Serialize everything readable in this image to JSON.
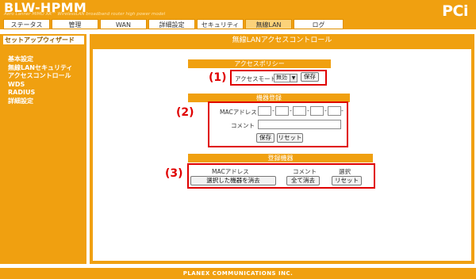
{
  "header": {
    "title": "BLW-HPMM",
    "subtitle": "Aero Lanner MIMO XR™ WirelessLAN broadband router high power model",
    "logo": "PCi"
  },
  "tabs": [
    "ステータス",
    "管理",
    "WAN",
    "詳細設定",
    "セキュリティ",
    "無線LAN",
    "ログ"
  ],
  "sidebar": {
    "heading": "セットアップウィザード",
    "items": [
      "基本設定",
      "無線LANセキュリティ",
      "アクセスコントロール",
      "WDS",
      "RADIUS",
      "詳細設定"
    ]
  },
  "main": {
    "title": "無線LANアクセスコントロール",
    "policy": {
      "title": "アクセスポリシー",
      "number": "(1)",
      "mode_label": "アクセスモード",
      "mode_value": "無効",
      "save": "保存"
    },
    "register": {
      "title": "機器登録",
      "number": "(2)",
      "mac_label": "MACアドレス",
      "comment_label": "コメント",
      "save": "保存",
      "reset": "リセット"
    },
    "registered": {
      "title": "登録機器",
      "number": "(3)",
      "col_mac": "MACアドレス",
      "col_comment": "コメント",
      "col_select": "選択",
      "delete_selected": "選択した機器を消去",
      "delete_all": "全て消去",
      "reset": "リセット"
    }
  },
  "footer": "PLANEX COMMUNICATIONS INC.",
  "colors": {
    "accent": "#f0a010",
    "highlight": "#e00000"
  }
}
